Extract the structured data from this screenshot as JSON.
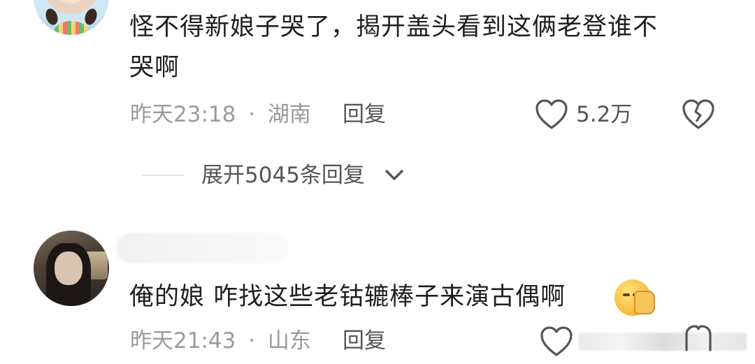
{
  "comments": [
    {
      "text": "怪不得新娘子哭了，揭开盖头看到这俩老登谁不哭啊",
      "text_line1": "怪不得新娘子哭了，揭开盖头看到这俩老登谁不",
      "text_line2": "哭啊",
      "time": "昨天23:18",
      "separator": "·",
      "location": "湖南",
      "reply_label": "回复",
      "like_count": "5.2万",
      "expand_label": "展开5045条回复"
    },
    {
      "text": "俺的娘 咋找这些老钴辘棒子来演古偶啊",
      "time": "昨天21:43",
      "separator": "·",
      "location": "山东",
      "reply_label": "回复",
      "like_count": ""
    }
  ],
  "icons": {
    "like": "heart-outline-icon",
    "dislike": "broken-heart-icon",
    "expand": "chevron-down-icon",
    "emoji": "face-palm-emoji-icon"
  },
  "colors": {
    "text": "#1f1f1f",
    "meta": "#9a9a9a",
    "action": "#555555"
  }
}
